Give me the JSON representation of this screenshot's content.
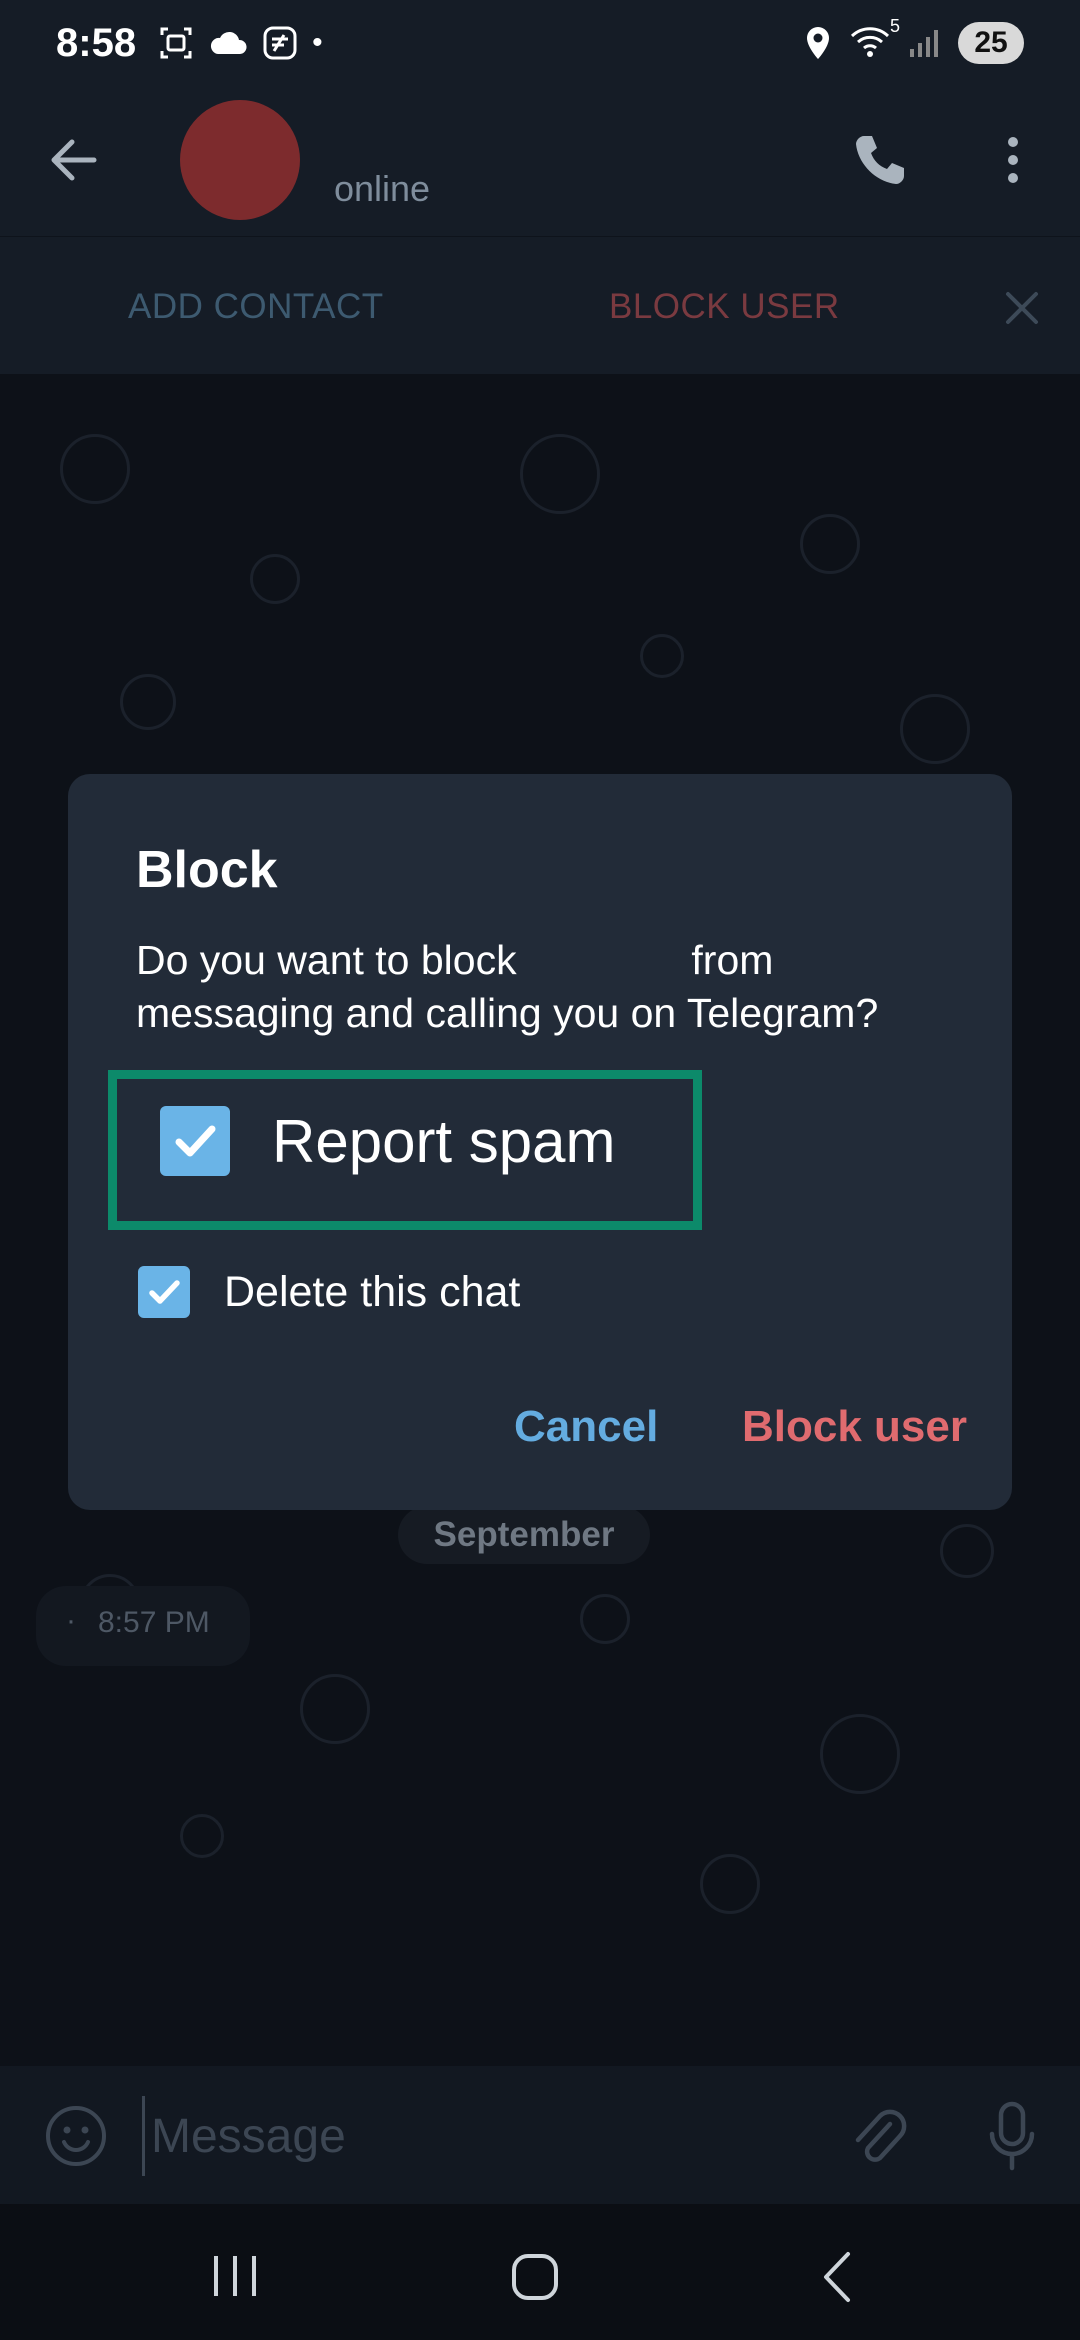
{
  "status_bar": {
    "time": "8:58",
    "battery": "25",
    "dot": "•",
    "wifi_sup": "5"
  },
  "header": {
    "contact_status": "online"
  },
  "action_bar": {
    "add_contact": "ADD CONTACT",
    "block_user": "BLOCK USER"
  },
  "chat": {
    "date_separator": "September",
    "message_time": "8:57 PM",
    "message_dot": "·"
  },
  "input": {
    "placeholder": "Message"
  },
  "dialog": {
    "title": "Block",
    "text_before": "Do you want to block",
    "text_after": "from messaging and calling you on Telegram?",
    "report_spam_label": "Report spam",
    "report_spam_checked": true,
    "delete_chat_label": "Delete this chat",
    "delete_chat_checked": true,
    "cancel_label": "Cancel",
    "block_label": "Block user"
  },
  "colors": {
    "accent_blue": "#64ace0",
    "danger_red": "#e06b6f",
    "highlight_green": "#0c8a6a",
    "checkbox_blue": "#6ab4e7"
  }
}
